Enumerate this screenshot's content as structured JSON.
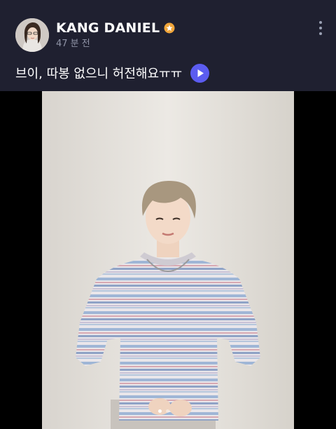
{
  "post": {
    "author": "KANG DANIEL",
    "time": "47 분 전",
    "caption": "브이, 따봉 없으니 허전해요ㅠㅠ"
  },
  "icons": {
    "badge": "orange-star-badge-icon",
    "more": "vertical-ellipsis-icon",
    "play": "play-icon"
  },
  "media": {
    "slide_count": 2,
    "active_slide": 1
  },
  "colors": {
    "header_bg": "#1f2030",
    "accent": "#5b5cf0",
    "badge": "#f0a53a",
    "timestamp": "#8f93a6"
  }
}
